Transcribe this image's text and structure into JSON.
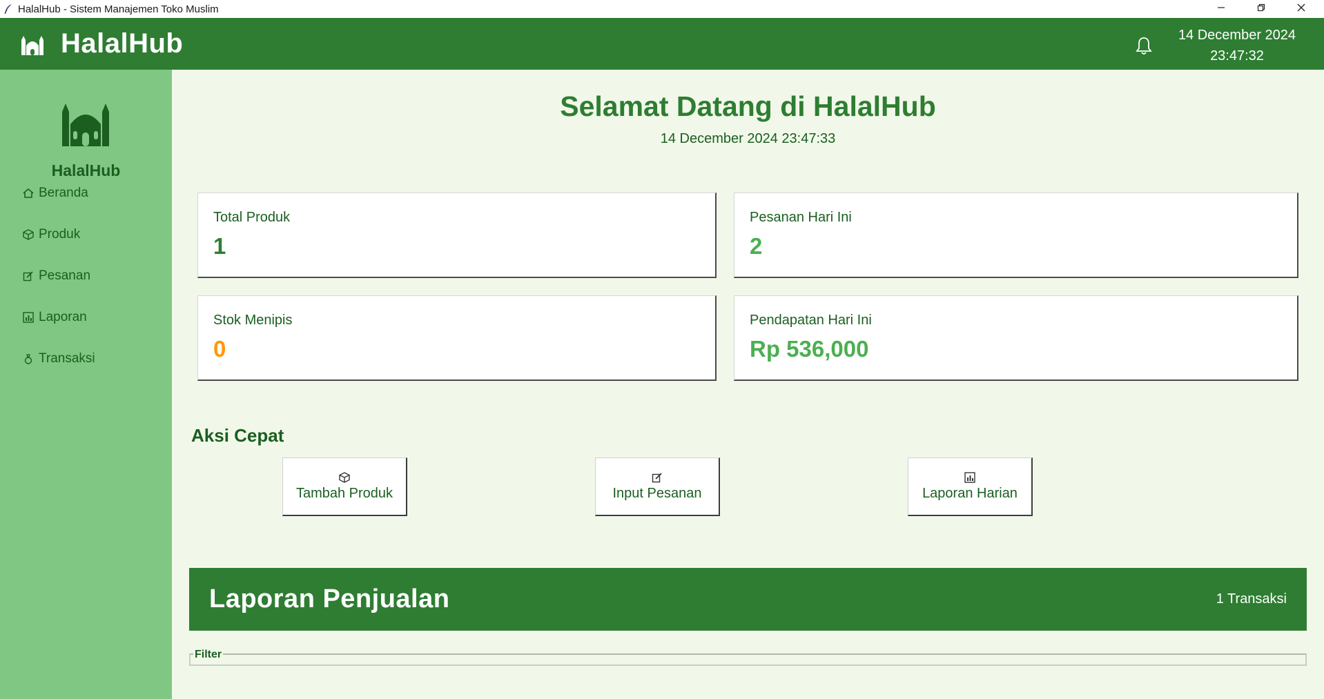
{
  "window": {
    "title": "HalalHub - Sistem Manajemen Toko Muslim",
    "icon": "feather-icon",
    "controls": [
      "minimize-icon",
      "restore-icon",
      "close-icon"
    ]
  },
  "header": {
    "brand": "HalalHub",
    "icon": "mosque-icon",
    "date": "14 December 2024",
    "time": "23:47:32",
    "notification_icon": "bell-icon"
  },
  "sidebar": {
    "logo_icon": "mosque-icon",
    "logo_text": "HalalHub",
    "items": [
      {
        "label": "Beranda",
        "icon": "home-icon"
      },
      {
        "label": "Produk",
        "icon": "package-icon"
      },
      {
        "label": "Pesanan",
        "icon": "edit-icon"
      },
      {
        "label": "Laporan",
        "icon": "bar-chart-icon"
      },
      {
        "label": "Transaksi",
        "icon": "money-bag-icon"
      }
    ]
  },
  "main": {
    "welcome_title": "Selamat Datang di HalalHub",
    "welcome_datetime": "14 December 2024 23:47:33",
    "cards": [
      {
        "label": "Total Produk",
        "value": "1",
        "color": "#2e7d32"
      },
      {
        "label": "Pesanan Hari Ini",
        "value": "2",
        "color": "#4caf50"
      },
      {
        "label": "Stok Menipis",
        "value": "0",
        "color": "#ff9800"
      },
      {
        "label": "Pendapatan Hari Ini",
        "value": "Rp 536,000",
        "color": "#4caf50"
      }
    ],
    "quick_actions": {
      "title": "Aksi Cepat",
      "buttons": [
        {
          "label": "Tambah Produk",
          "icon": "package-icon"
        },
        {
          "label": "Input Pesanan",
          "icon": "edit-icon"
        },
        {
          "label": "Laporan Harian",
          "icon": "bar-chart-icon"
        }
      ]
    },
    "report": {
      "title": "Laporan Penjualan",
      "count": "1 Transaksi",
      "filter_label": "Filter"
    }
  },
  "colors": {
    "header_green": "#2e7d32",
    "sidebar_green": "#81c784",
    "main_background": "#f1f8e9",
    "dark_green_text": "#1b5e20"
  }
}
